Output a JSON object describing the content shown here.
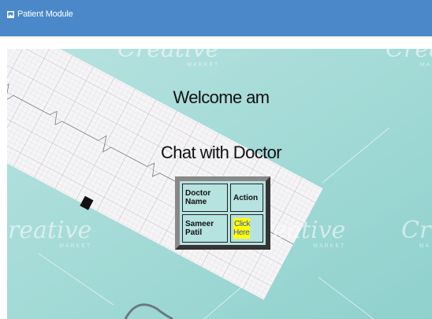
{
  "header": {
    "brand_icon": "picture-icon",
    "title": "Patient Module",
    "background_color": "#4a88c9"
  },
  "hero": {
    "welcome_text": "Welcome am",
    "chat_title": "Chat with Doctor",
    "background_color": "#a9dddb"
  },
  "doctors_table": {
    "headers": [
      "Doctor Name",
      "Action"
    ],
    "rows": [
      {
        "doctor_name": "Sameer Patil",
        "action_label": "Click Here"
      }
    ]
  },
  "colors": {
    "link_highlight": "#ffff00",
    "link_text": "#3a4bd0"
  }
}
